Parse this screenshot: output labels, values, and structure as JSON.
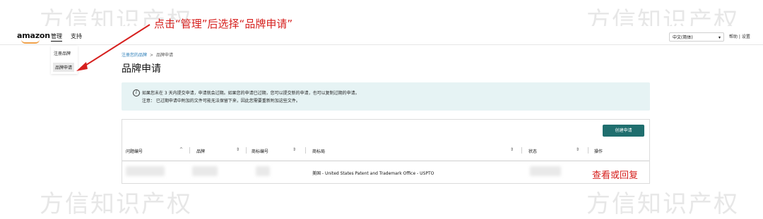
{
  "watermarks": [
    "方信知识产权",
    "方信知识产权",
    "方信知识产权",
    "方信知识产权"
  ],
  "header": {
    "logo": "amazon",
    "nav": [
      "管理",
      "支持"
    ],
    "language": "中文(简体)",
    "links": "帮助 | 设置"
  },
  "dropdown": {
    "items": [
      "注册品牌",
      "品牌申请"
    ]
  },
  "annotation": "点击“管理”后选择“品牌申请”",
  "breadcrumb": {
    "parent": "注册您的品牌",
    "separator": ">",
    "current": "品牌申请"
  },
  "page_title": "品牌申请",
  "alert": {
    "line1": "如果您未在 3 天内提交申请，申请就会过期。如果您的申请已过期，您可以提交新的申请，也可以复制过期的申请。",
    "line2": "注意： 已过期申请中附加的文件可能无法保留下来，因此您需要重新附加这些文件。"
  },
  "create_button": "创建申请",
  "table": {
    "headers": [
      "问题编号",
      "品牌",
      "商标编号",
      "商标局",
      "状态",
      "操作"
    ],
    "row": {
      "trademark_office": "美国 - United States Patent and Trademark Office - USPTO",
      "action": "查看或回复"
    }
  },
  "colors": {
    "annotation_red": "#d6201e",
    "button_teal": "#1f6e6e",
    "alert_bg": "#e6f3f4",
    "link_blue": "#2a7db8"
  },
  "icons": [
    "info-icon",
    "sort-icon",
    "dropdown-caret-icon",
    "arrow-annotation-icon"
  ]
}
